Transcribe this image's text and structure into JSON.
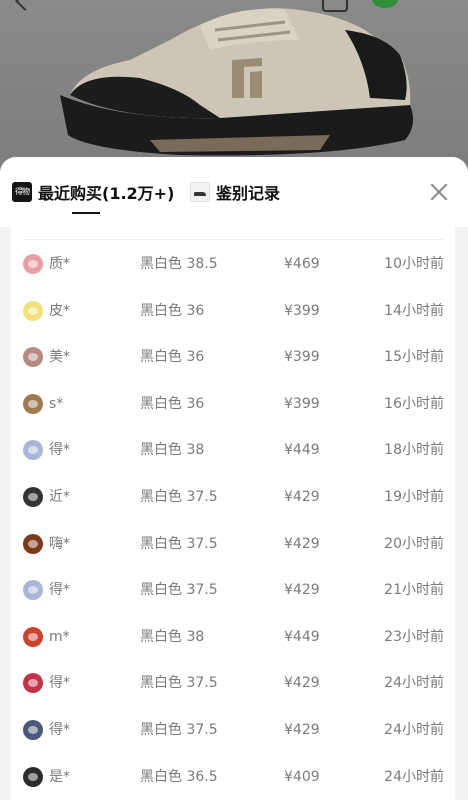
{
  "tabs": [
    {
      "label": "最近购买(1.2万+)",
      "icon": "dewu-logo-icon",
      "icon_text": "得物",
      "active": true
    },
    {
      "label": "鉴别记录",
      "icon": "shoe-thumbnail-icon",
      "active": false
    }
  ],
  "close_icon": "close-icon",
  "purchases": [
    {
      "user": "质*",
      "spec": "黑白色 38.5",
      "price": "¥469",
      "time": "10小时前",
      "avatar_color": "#e8a0a8"
    },
    {
      "user": "皮*",
      "spec": "黑白色 36",
      "price": "¥399",
      "time": "14小时前",
      "avatar_color": "#f2e07a"
    },
    {
      "user": "美*",
      "spec": "黑白色 36",
      "price": "¥399",
      "time": "15小时前",
      "avatar_color": "#b48a82"
    },
    {
      "user": "s*",
      "spec": "黑白色 36",
      "price": "¥399",
      "time": "16小时前",
      "avatar_color": "#9c7a52"
    },
    {
      "user": "得*",
      "spec": "黑白色 38",
      "price": "¥449",
      "time": "18小时前",
      "avatar_color": "#a9b6d6"
    },
    {
      "user": "近*",
      "spec": "黑白色 37.5",
      "price": "¥429",
      "time": "19小时前",
      "avatar_color": "#333333"
    },
    {
      "user": "嗨*",
      "spec": "黑白色 37.5",
      "price": "¥429",
      "time": "20小时前",
      "avatar_color": "#7a3a1c"
    },
    {
      "user": "得*",
      "spec": "黑白色 37.5",
      "price": "¥429",
      "time": "21小时前",
      "avatar_color": "#a9b6d6"
    },
    {
      "user": "m*",
      "spec": "黑白色 38",
      "price": "¥449",
      "time": "23小时前",
      "avatar_color": "#c8462e"
    },
    {
      "user": "得*",
      "spec": "黑白色 37.5",
      "price": "¥429",
      "time": "24小时前",
      "avatar_color": "#c2334a"
    },
    {
      "user": "得*",
      "spec": "黑白色 37.5",
      "price": "¥429",
      "time": "24小时前",
      "avatar_color": "#4a5a78"
    },
    {
      "user": "是*",
      "spec": "黑白色 36.5",
      "price": "¥409",
      "time": "24小时前",
      "avatar_color": "#2c2c2c"
    }
  ]
}
